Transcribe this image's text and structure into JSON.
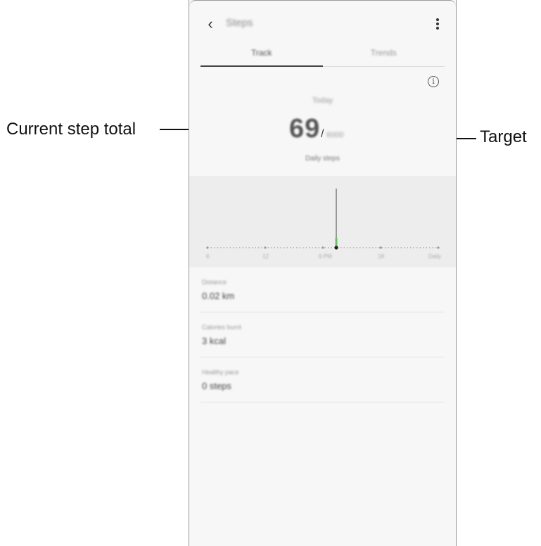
{
  "callouts": {
    "current_step_total": "Current step total",
    "target": "Target"
  },
  "app": {
    "title": "Steps",
    "back_icon": "chevron-left-icon",
    "menu_icon": "more-vertical-icon"
  },
  "tabs": [
    {
      "label": "Track",
      "selected": true
    },
    {
      "label": "Trends",
      "selected": false
    }
  ],
  "summary": {
    "day_label": "Today",
    "steps": "69",
    "separator": "/",
    "target": "6000",
    "caption": "Daily steps",
    "info_icon": "info-icon"
  },
  "chart_axis": {
    "labels": [
      "6",
      "12",
      "6 PM",
      "18",
      "Daily"
    ]
  },
  "stats": [
    {
      "label": "Distance",
      "value": "0.02 km"
    },
    {
      "label": "Calories burnt",
      "value": "3 kcal"
    },
    {
      "label": "Healthy pace",
      "value": "0 steps"
    }
  ],
  "colors": {
    "leader_line": "#1d5f9a",
    "bar": "#6abf69",
    "background": "#f7f7f7"
  }
}
